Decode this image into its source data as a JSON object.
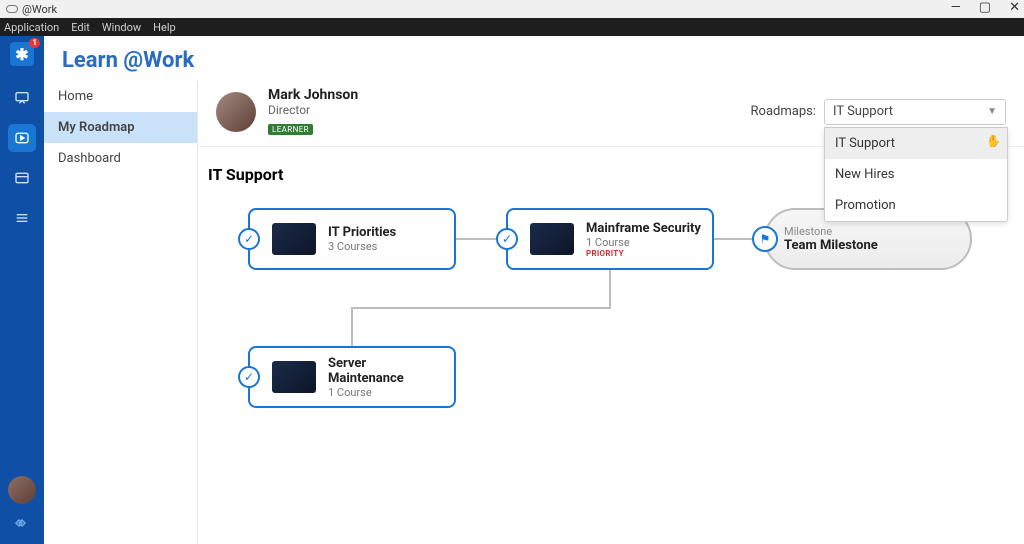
{
  "titlebar": {
    "title": "@Work"
  },
  "win_controls": {
    "min": "—",
    "max": "▢",
    "close": "✕"
  },
  "menubar": [
    "Application",
    "Edit",
    "Window",
    "Help"
  ],
  "rail": {
    "badge": "1"
  },
  "page_title": "Learn @Work",
  "sidebar": {
    "items": [
      {
        "label": "Home"
      },
      {
        "label": "My Roadmap"
      },
      {
        "label": "Dashboard"
      }
    ]
  },
  "profile": {
    "name": "Mark Johnson",
    "role": "Director",
    "badge": "LEARNER"
  },
  "picker": {
    "label": "Roadmaps:",
    "selected": "IT Support",
    "options": [
      {
        "label": "IT Support",
        "hover": true
      },
      {
        "label": "New Hires"
      },
      {
        "label": "Promotion"
      }
    ]
  },
  "section_title": "IT Support",
  "cards": {
    "c1": {
      "title": "IT Priorities",
      "sub": "3 Courses"
    },
    "c2": {
      "title": "Mainframe Security",
      "sub": "1 Course",
      "priority": "PRIORITY"
    },
    "c3": {
      "title": "Server Maintenance",
      "sub": "1 Course"
    }
  },
  "milestone": {
    "label": "Milestone",
    "title": "Team Milestone"
  }
}
